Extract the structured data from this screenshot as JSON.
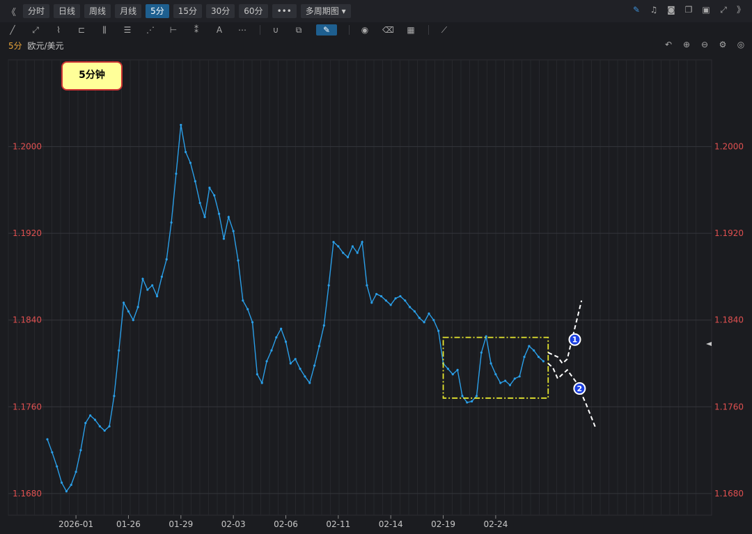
{
  "toolbar": {
    "collapse_icon": "double-chevron-left-icon",
    "periods": [
      {
        "label": "分时",
        "active": false
      },
      {
        "label": "日线",
        "active": false
      },
      {
        "label": "周线",
        "active": false
      },
      {
        "label": "月线",
        "active": false
      },
      {
        "label": "5分",
        "active": true
      },
      {
        "label": "15分",
        "active": false
      },
      {
        "label": "30分",
        "active": false
      },
      {
        "label": "60分",
        "active": false
      }
    ],
    "more_label": "•••",
    "multi_period_label": "多周期图 ▾",
    "right_icons": [
      "pencil-icon",
      "bell-icon",
      "camera-icon",
      "copy-icon",
      "monitor-icon",
      "fullscreen-icon",
      "double-chevron-right-icon"
    ]
  },
  "drawing_tools": [
    "line-tool-icon",
    "ray-tool-icon",
    "polyline-tool-icon",
    "channel-tool-icon",
    "fork-tool-icon",
    "fib-tool-icon",
    "gann-tool-icon",
    "measure-tool-icon",
    "pattern-tool-icon",
    "text-tool-icon",
    "more-tools-icon",
    "magnet-icon",
    "layers-icon",
    "draw-mode-icon",
    "eye-icon",
    "trash-icon",
    "grid-icon",
    "ruler-icon"
  ],
  "symbol": {
    "timeframe": "5分",
    "name": "欧元/美元"
  },
  "chart_controls": [
    "undo-icon",
    "zoom-in-icon",
    "zoom-out-icon",
    "settings-icon",
    "target-icon"
  ],
  "badge": {
    "label": "5分钟"
  },
  "colors": {
    "price_line": "#2a9fe8",
    "price_label": "#e05050",
    "box": "#e6e62e",
    "projection": "#ffffff",
    "marker_fill": "#1a3ee0"
  },
  "chart_data": {
    "type": "line",
    "ylim": [
      1.166,
      1.208
    ],
    "yticks": [
      "1.1680",
      "1.1760",
      "1.1840",
      "1.1920",
      "1.2000"
    ],
    "ytick_values": [
      1.168,
      1.176,
      1.184,
      1.192,
      1.2
    ],
    "xticks": [
      "2026-01",
      "01-26",
      "01-29",
      "02-03",
      "02-06",
      "02-11",
      "02-14",
      "02-19",
      "02-24"
    ],
    "xtick_index": [
      6,
      17,
      28,
      39,
      50,
      61,
      72,
      83,
      94
    ],
    "x_count": 120,
    "prices": [
      1.173,
      1.1718,
      1.1705,
      1.169,
      1.1682,
      1.1688,
      1.17,
      1.172,
      1.1745,
      1.1752,
      1.1748,
      1.1742,
      1.1738,
      1.1742,
      1.177,
      1.1812,
      1.1856,
      1.1848,
      1.184,
      1.1852,
      1.1878,
      1.1868,
      1.1872,
      1.1862,
      1.188,
      1.1896,
      1.193,
      1.1975,
      1.202,
      1.1995,
      1.1985,
      1.1968,
      1.1948,
      1.1935,
      1.1962,
      1.1955,
      1.1938,
      1.1915,
      1.1935,
      1.1922,
      1.1895,
      1.1858,
      1.185,
      1.1838,
      1.179,
      1.1782,
      1.1802,
      1.1812,
      1.1824,
      1.1832,
      1.182,
      1.18,
      1.1804,
      1.1795,
      1.1788,
      1.1782,
      1.1798,
      1.1816,
      1.1835,
      1.1872,
      1.1912,
      1.1908,
      1.1902,
      1.1898,
      1.1908,
      1.1902,
      1.1912,
      1.1872,
      1.1856,
      1.1864,
      1.1862,
      1.1858,
      1.1854,
      1.186,
      1.1862,
      1.1858,
      1.1852,
      1.1848,
      1.1842,
      1.1838,
      1.1846,
      1.184,
      1.183,
      1.18,
      1.1795,
      1.179,
      1.1794,
      1.177,
      1.1764,
      1.1765,
      1.177,
      1.181,
      1.1825,
      1.18,
      1.179,
      1.1782,
      1.1784,
      1.178,
      1.1786,
      1.1788,
      1.1806,
      1.1816,
      1.1812,
      1.1806,
      1.1802
    ],
    "box": {
      "x_start": 83,
      "x_end": 105,
      "y_low": 1.1768,
      "y_high": 1.1824
    },
    "projections": [
      {
        "label": "1",
        "points": [
          [
            105,
            1.181
          ],
          [
            107,
            1.1806
          ],
          [
            108,
            1.18
          ],
          [
            109,
            1.1804
          ],
          [
            110,
            1.1822
          ],
          [
            112,
            1.1858
          ]
        ]
      },
      {
        "label": "2",
        "points": [
          [
            105,
            1.18
          ],
          [
            106,
            1.1796
          ],
          [
            107,
            1.1786
          ],
          [
            109,
            1.1794
          ],
          [
            111,
            1.1782
          ],
          [
            113,
            1.1762
          ],
          [
            115,
            1.174
          ]
        ]
      }
    ]
  }
}
